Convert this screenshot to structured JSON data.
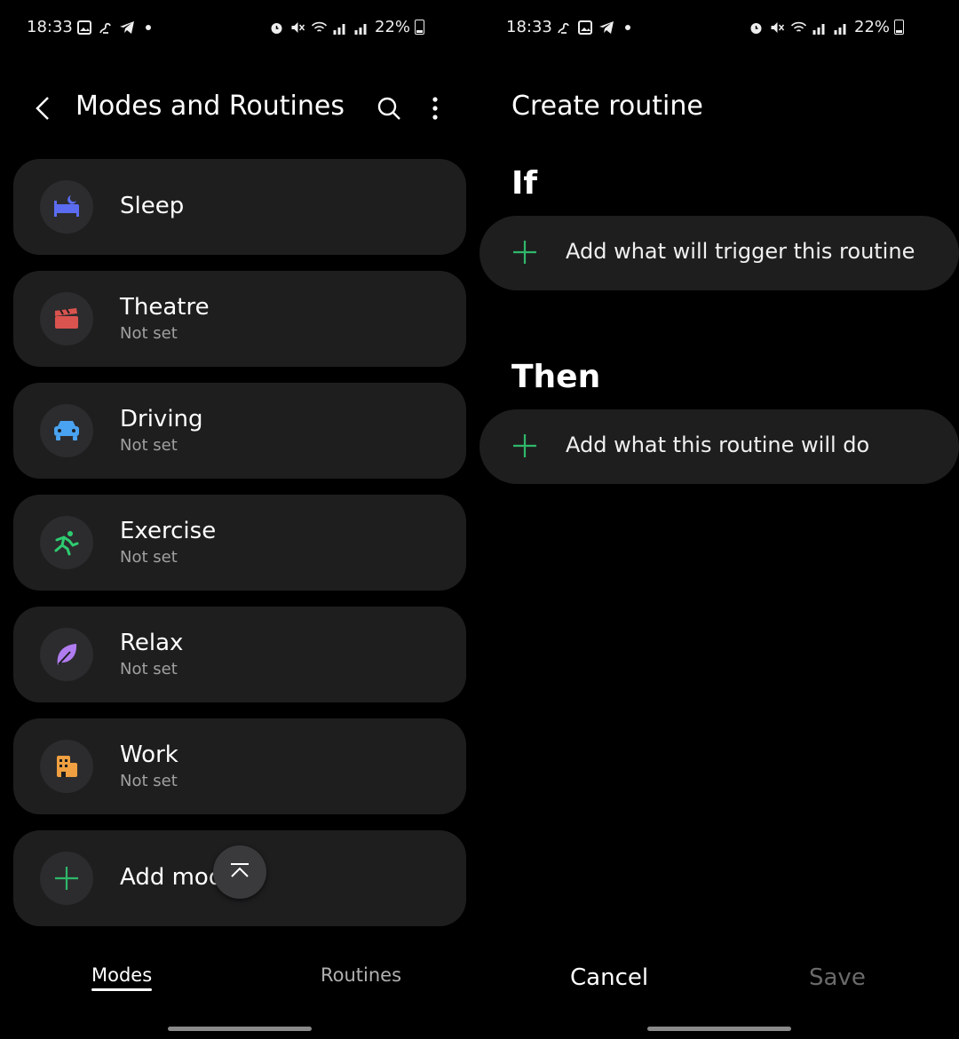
{
  "status_left": {
    "time": "18:33",
    "battery": "22%"
  },
  "status_right": {
    "time": "18:33",
    "battery": "22%"
  },
  "modes_screen": {
    "title": "Modes and Routines",
    "modes": [
      {
        "name": "Sleep",
        "subtitle": "",
        "icon": "sleep-bed-icon",
        "color": "#5b6cf0"
      },
      {
        "name": "Theatre",
        "subtitle": "Not set",
        "icon": "clapperboard-icon",
        "color": "#d9534f"
      },
      {
        "name": "Driving",
        "subtitle": "Not set",
        "icon": "car-icon",
        "color": "#4aa3f0"
      },
      {
        "name": "Exercise",
        "subtitle": "Not set",
        "icon": "running-icon",
        "color": "#2ecc71"
      },
      {
        "name": "Relax",
        "subtitle": "Not set",
        "icon": "leaf-icon",
        "color": "#b07cf0"
      },
      {
        "name": "Work",
        "subtitle": "Not set",
        "icon": "building-icon",
        "color": "#f0a040"
      }
    ],
    "add_mode_label": "Add mod",
    "tabs": {
      "modes": "Modes",
      "routines": "Routines"
    }
  },
  "routine_screen": {
    "title": "Create routine",
    "if_label": "If",
    "if_action": "Add what will trigger this routine",
    "then_label": "Then",
    "then_action": "Add what this routine will do",
    "cancel_label": "Cancel",
    "save_label": "Save"
  },
  "colors": {
    "accent_green": "#2fb86a",
    "card_bg": "#1e1e1f"
  }
}
